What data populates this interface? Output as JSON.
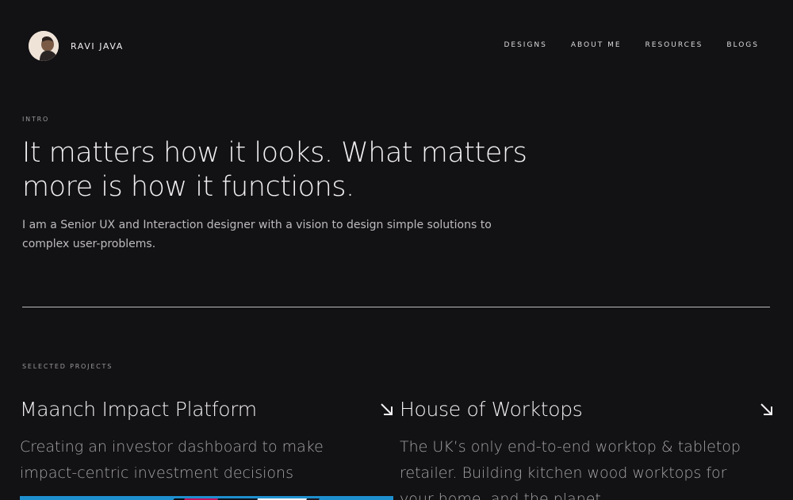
{
  "header": {
    "brand": "RAVI JAVA",
    "nav": [
      "DESIGNS",
      "ABOUT ME",
      "RESOURCES",
      "BLOGS"
    ]
  },
  "intro": {
    "eyebrow": "INTRO",
    "headline": "It matters how it looks. What matters more is how it functions.",
    "text": "I am a Senior UX and Interaction designer with a vision to design simple solutions to complex user-problems."
  },
  "projects": {
    "eyebrow": "SELECTED PROJECTS",
    "items": [
      {
        "title": "Maanch Impact Platform",
        "description": "Creating an investor dashboard to make impact-centric investment decisions"
      },
      {
        "title": "House of Worktops",
        "description": "The UK’s only end-to-end worktop & tabletop retailer. Building kitchen wood worktops for your home, and the planet"
      }
    ]
  },
  "colors": {
    "background": "#121113",
    "text": "#f2f0f3",
    "muted": "#a4a2a6",
    "thumbnail_accent": "#1e8fce"
  }
}
